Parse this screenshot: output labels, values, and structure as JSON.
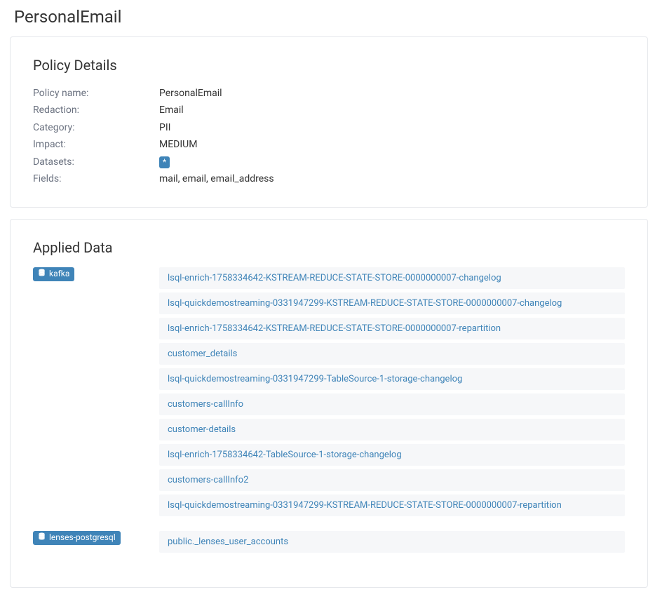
{
  "page_title": "PersonalEmail",
  "policy_details": {
    "heading": "Policy Details",
    "rows": [
      {
        "label": "Policy name:",
        "value": "PersonalEmail"
      },
      {
        "label": "Redaction:",
        "value": "Email"
      },
      {
        "label": "Category:",
        "value": "PII"
      },
      {
        "label": "Impact:",
        "value": "MEDIUM"
      },
      {
        "label": "Datasets:",
        "value": "*",
        "badge": true
      },
      {
        "label": "Fields:",
        "value": "mail, email, email_address"
      }
    ]
  },
  "applied_data": {
    "heading": "Applied Data",
    "sources": [
      {
        "name": "kafka",
        "topics": [
          "lsql-enrich-1758334642-KSTREAM-REDUCE-STATE-STORE-0000000007-changelog",
          "lsql-quickdemostreaming-0331947299-KSTREAM-REDUCE-STATE-STORE-0000000007-changelog",
          "lsql-enrich-1758334642-KSTREAM-REDUCE-STATE-STORE-0000000007-repartition",
          "customer_details",
          "lsql-quickdemostreaming-0331947299-TableSource-1-storage-changelog",
          "customers-callInfo",
          "customer-details",
          "lsql-enrich-1758334642-TableSource-1-storage-changelog",
          "customers-callInfo2",
          "lsql-quickdemostreaming-0331947299-KSTREAM-REDUCE-STATE-STORE-0000000007-repartition"
        ]
      },
      {
        "name": "lenses-postgresql",
        "topics": [
          "public._lenses_user_accounts"
        ]
      }
    ]
  }
}
